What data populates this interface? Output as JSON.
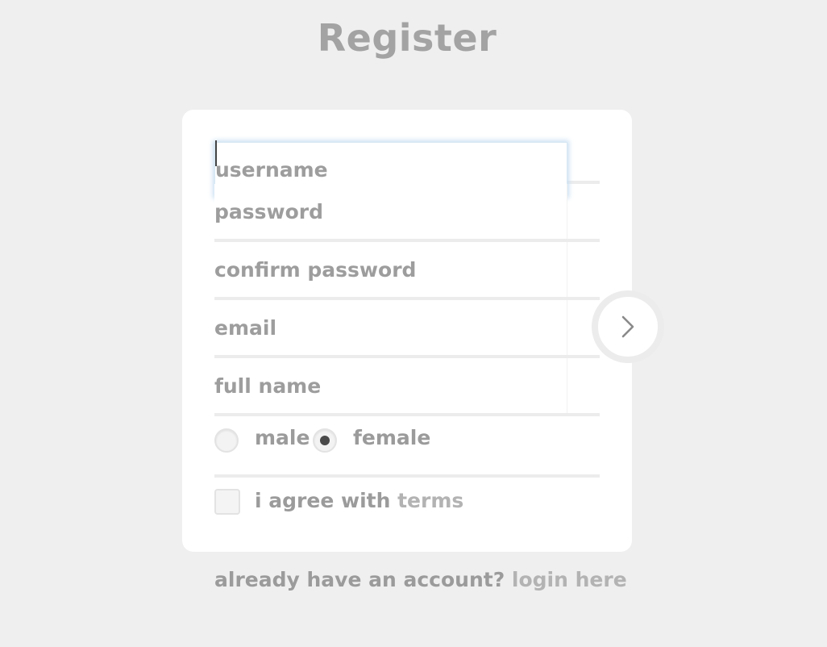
{
  "page": {
    "title": "Register"
  },
  "form": {
    "username": {
      "placeholder": "username",
      "value": ""
    },
    "password": {
      "placeholder": "password",
      "value": ""
    },
    "confirm_password": {
      "placeholder": "confirm password",
      "value": ""
    },
    "email": {
      "placeholder": "email",
      "value": ""
    },
    "full_name": {
      "placeholder": "full name",
      "value": ""
    },
    "gender": {
      "options": [
        "male",
        "female"
      ],
      "selected": "female"
    },
    "terms": {
      "prefix": "i agree with ",
      "link_label": "terms",
      "checked": false
    },
    "submit": {
      "icon": "chevron-right-icon"
    }
  },
  "footer": {
    "prefix": "already have an account? ",
    "link_label": "login here"
  },
  "colors": {
    "background": "#efefef",
    "card": "#ffffff",
    "text": "#9b9b9b",
    "link": "#b3b3b3",
    "focus": "#c9dff2"
  }
}
